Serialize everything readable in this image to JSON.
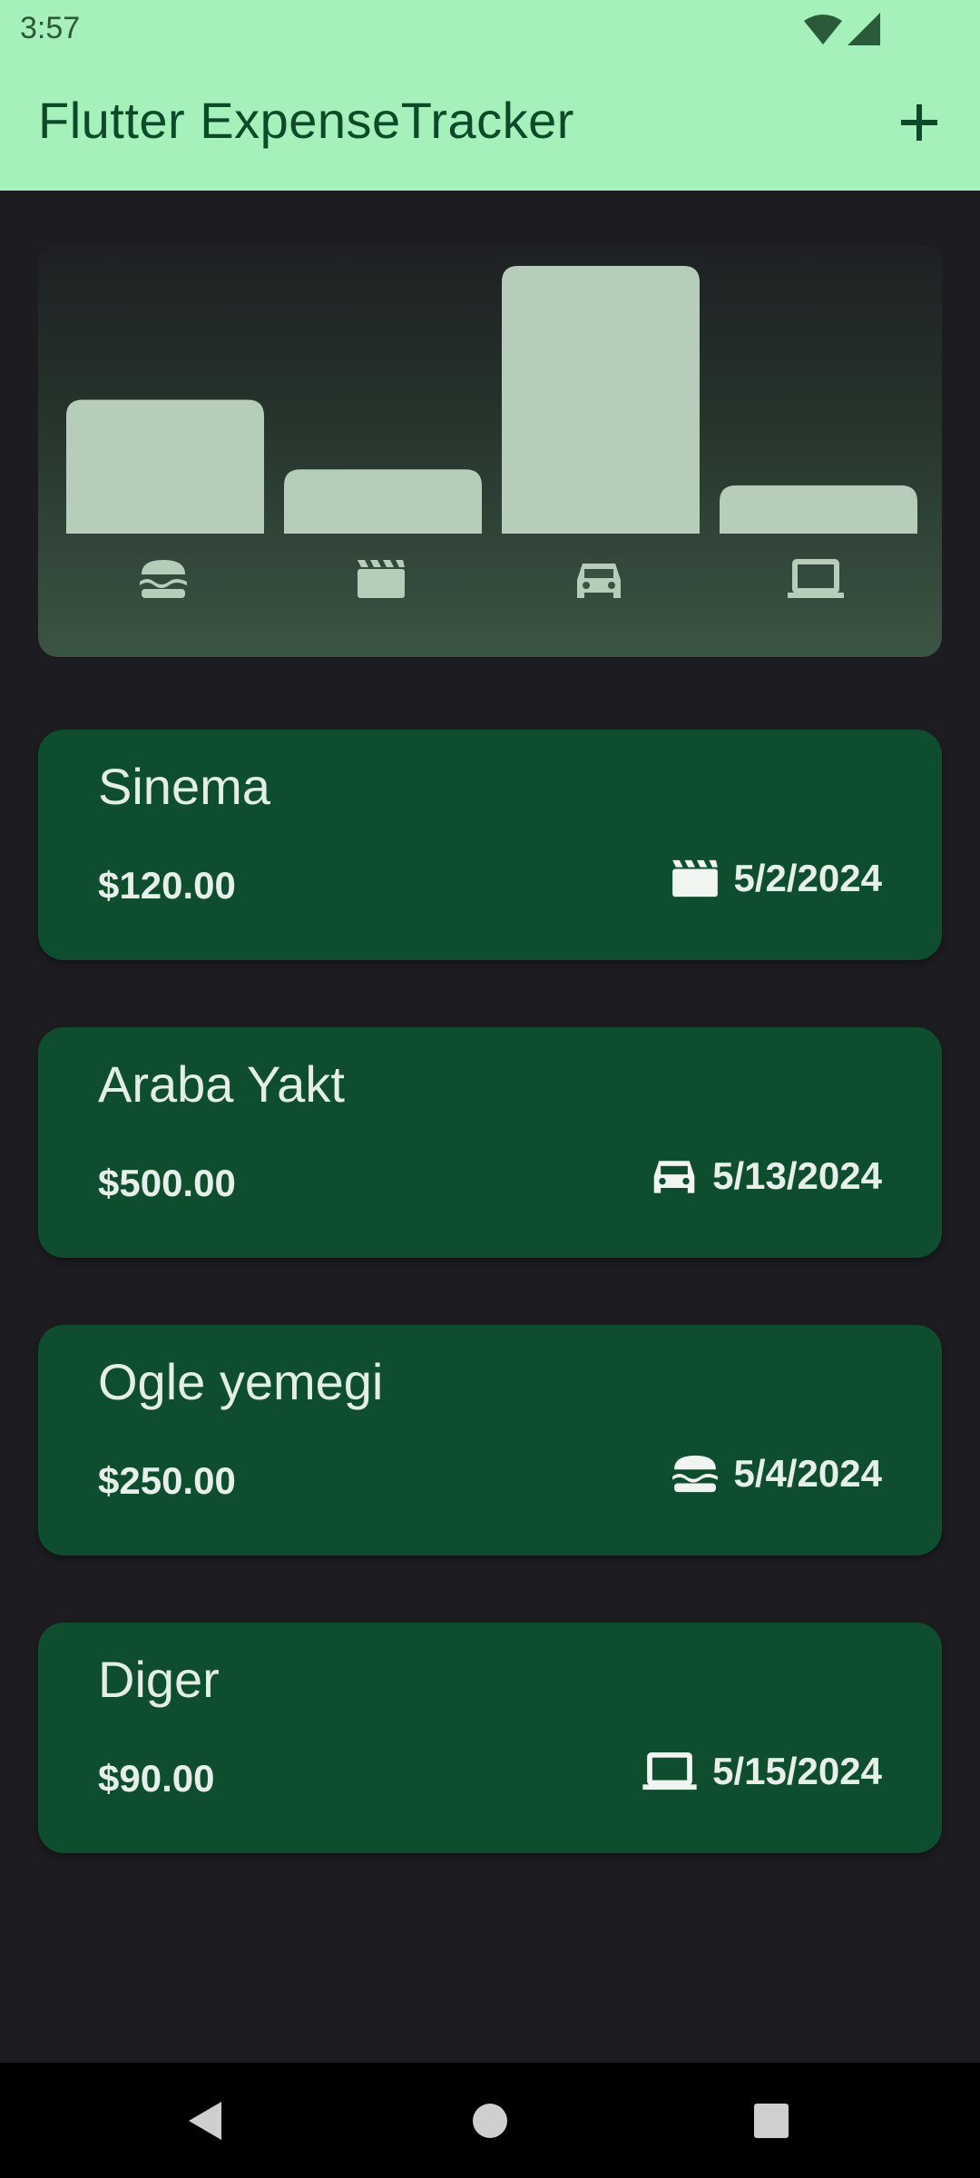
{
  "status_bar": {
    "time": "3:57"
  },
  "app_bar": {
    "title": "Flutter ExpenseTracker",
    "add_icon": "plus-icon"
  },
  "colors": {
    "app_bar": "#a6f0bb",
    "background": "#1d1c21",
    "card": "#0f4d2f",
    "bar": "#b6cdb9"
  },
  "chart_data": {
    "type": "bar",
    "categories": [
      "food",
      "leisure",
      "travel",
      "work"
    ],
    "category_icons": [
      "burger-icon",
      "movie-clapper-icon",
      "car-icon",
      "laptop-icon"
    ],
    "values": [
      250,
      120,
      500,
      90
    ],
    "ylim": [
      0,
      500
    ]
  },
  "expenses": [
    {
      "title": "Sinema",
      "amount": "$120.00",
      "date": "5/2/2024",
      "icon": "movie-clapper-icon"
    },
    {
      "title": "Araba Yakt",
      "amount": "$500.00",
      "date": "5/13/2024",
      "icon": "car-icon"
    },
    {
      "title": "Ogle yemegi",
      "amount": "$250.00",
      "date": "5/4/2024",
      "icon": "burger-icon"
    },
    {
      "title": "Diger",
      "amount": "$90.00",
      "date": "5/15/2024",
      "icon": "laptop-icon"
    }
  ],
  "nav_bar": {
    "back_icon": "back-icon",
    "home_icon": "home-icon",
    "recents_icon": "recents-icon"
  }
}
